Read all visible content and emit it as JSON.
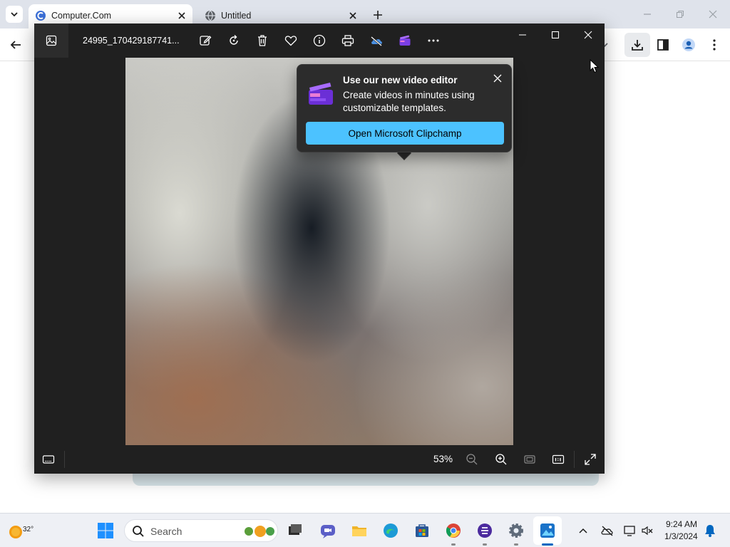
{
  "browser": {
    "tabs": [
      {
        "title": "Computer.Com",
        "active": true
      },
      {
        "title": "Untitled",
        "active": false
      }
    ]
  },
  "photos": {
    "filename": "24995_170429187741...",
    "zoom": "53%",
    "toolbar_icons": [
      "edit-icon",
      "rotate-icon",
      "delete-icon",
      "favorite-icon",
      "info-icon",
      "print-icon",
      "onedrive-icon",
      "clipchamp-icon",
      "more-icon"
    ]
  },
  "tip": {
    "title": "Use our new video editor",
    "body": "Create videos in minutes using customizable templates.",
    "button": "Open Microsoft Clipchamp"
  },
  "taskbar": {
    "weather_temp": "32°",
    "search_placeholder": "Search",
    "time": "9:24 AM",
    "date": "1/3/2024"
  },
  "colors": {
    "accent": "#4cc2ff",
    "photos_bg": "#202020",
    "tip_bg": "#2c2c2c",
    "taskbar_bg": "#eef0f5"
  }
}
